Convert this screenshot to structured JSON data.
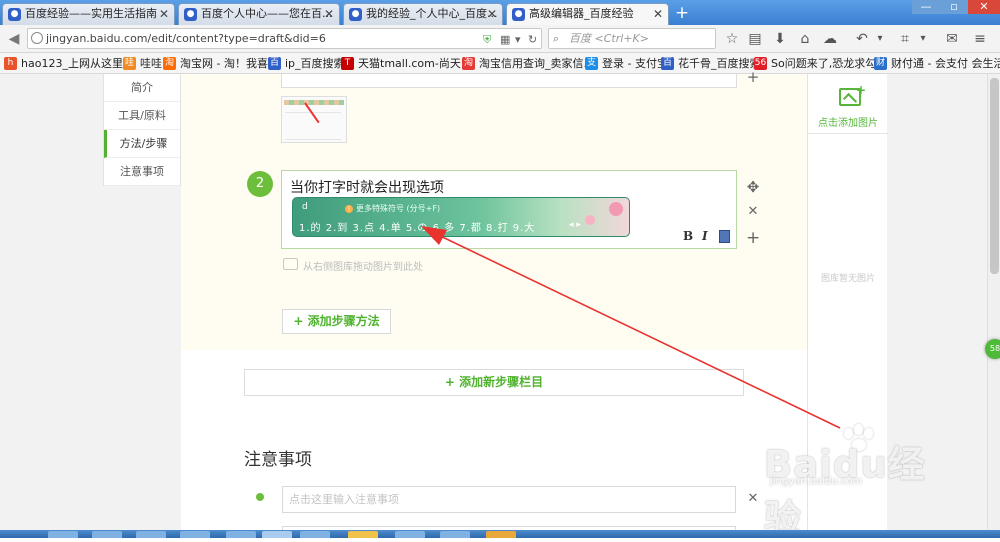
{
  "browser": {
    "tabs": [
      {
        "label": "百度经验——实用生活指南",
        "active": false
      },
      {
        "label": "百度个人中心——您在百...",
        "active": false
      },
      {
        "label": "我的经验_个人中心_百度...",
        "active": false
      },
      {
        "label": "高级编辑器_百度经验",
        "active": true
      }
    ],
    "new_tab": "+",
    "window_controls": {
      "minimize": "—",
      "restore": "▫",
      "close": "✕"
    },
    "url": "jingyan.baidu.com/edit/content?type=draft&did=6",
    "search_placeholder": "百度 <Ctrl+K>",
    "bookmarks": [
      {
        "label": "hao123_上网从这里...",
        "icon_text": "h",
        "color": "#e8532b"
      },
      {
        "label": "哇哇",
        "icon_text": "哇",
        "color": "#f08a24"
      },
      {
        "label": "淘宝网 - 淘！我喜欢",
        "icon_text": "淘",
        "color": "#ff6a00"
      },
      {
        "label": "ip_百度搜索",
        "icon_text": "百",
        "color": "#2f5fc7"
      },
      {
        "label": "天猫tmall.com-尚天...",
        "icon_text": "T",
        "color": "#c40000"
      },
      {
        "label": "淘宝信用查询_卖家信...",
        "icon_text": "淘",
        "color": "#e53935"
      },
      {
        "label": "登录 - 支付宝",
        "icon_text": "支",
        "color": "#1b8ee8"
      },
      {
        "label": "花千骨_百度搜索",
        "icon_text": "百",
        "color": "#2f5fc7"
      },
      {
        "label": "So问题来了,恐龙求勾...",
        "icon_text": "56",
        "color": "#e21f26"
      },
      {
        "label": "财付通 - 会支付 会生活",
        "icon_text": "财",
        "color": "#2a6fc9"
      }
    ]
  },
  "sidebar": {
    "items": [
      {
        "label": "简介"
      },
      {
        "label": "工具/原料"
      },
      {
        "label": "方法/步骤",
        "active": true
      },
      {
        "label": "注意事项"
      }
    ]
  },
  "step": {
    "number": "2",
    "text": "当你打字时就会出现选项",
    "ime": {
      "logo": "d",
      "hint_icon": "!",
      "hint": "更多特殊符号 (分号+F)",
      "candidates": "1.的  2.到  3.点  4.单  5.の  6.多  7.都  8.打  9.大",
      "nav": "◂ ▸"
    },
    "format_bold": "B",
    "format_italic": "I",
    "drag_hint": "从右侧图库拖动图片到此处"
  },
  "buttons": {
    "add_method": "+ 添加步骤方法",
    "add_step_section": "+ 添加新步骤栏目"
  },
  "notes": {
    "title": "注意事项",
    "placeholder": "点击这里输入注意事项"
  },
  "image_panel": {
    "add_label": "点击添加图片",
    "empty_label": "图库暂无图片"
  },
  "watermark": {
    "brand": "Baidu经验",
    "url": "jingyan.baidu.com"
  },
  "floating_badge": "58"
}
